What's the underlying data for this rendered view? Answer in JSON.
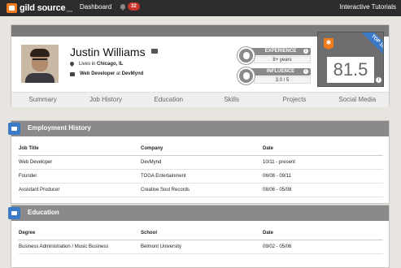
{
  "nav": {
    "logo_text": "gild source",
    "logo_tm": "beta",
    "dashboard_label": "Dashboard",
    "notification_count": "32",
    "tutorials_label": "Interactive Tutorials"
  },
  "profile": {
    "name": "Justin Williams",
    "lives_in_prefix": "Lives in",
    "location": "Chicago, IL",
    "job_title": "Web Developer",
    "job_at": "at",
    "company": "DevMynd",
    "experience_label": "EXPERIENCE",
    "experience_value": "8+ years",
    "influence_label": "INFLUENCE",
    "influence_value": "3.0 / 5",
    "score": "81.5",
    "ribbon_label": "TOP 10%",
    "info_glyph": "i"
  },
  "tabs": [
    "Summary",
    "Job History",
    "Education",
    "Skills",
    "Projects",
    "Social Media"
  ],
  "employment": {
    "title": "Employment History",
    "columns": [
      "Job Title",
      "Company",
      "Date"
    ],
    "rows": [
      [
        "Web Developer",
        "DevMynd",
        "10/11 - present"
      ],
      [
        "Founder",
        "TOGA Entertainment",
        "06/08 - 09/11"
      ],
      [
        "Assistant Producer",
        "Creative Soul Records",
        "08/06 - 05/08"
      ]
    ]
  },
  "education": {
    "title": "Education",
    "columns": [
      "Degree",
      "School",
      "Date"
    ],
    "rows": [
      [
        "Business Administration / Music Business",
        "Belmont University",
        "09/02 - 05/06"
      ]
    ]
  },
  "colors": {
    "nav_bg": "#2c2c2c",
    "accent_orange": "#f07b1d",
    "accent_blue": "#3c79c6",
    "badge_red": "#c8352e",
    "header_gray": "#8a8a8a"
  },
  "icons": [
    "bell-icon",
    "mail-icon",
    "location-pin-icon",
    "briefcase-icon",
    "experience-icon",
    "influence-icon",
    "star-badge-icon",
    "info-icon",
    "employment-icon",
    "education-icon"
  ]
}
